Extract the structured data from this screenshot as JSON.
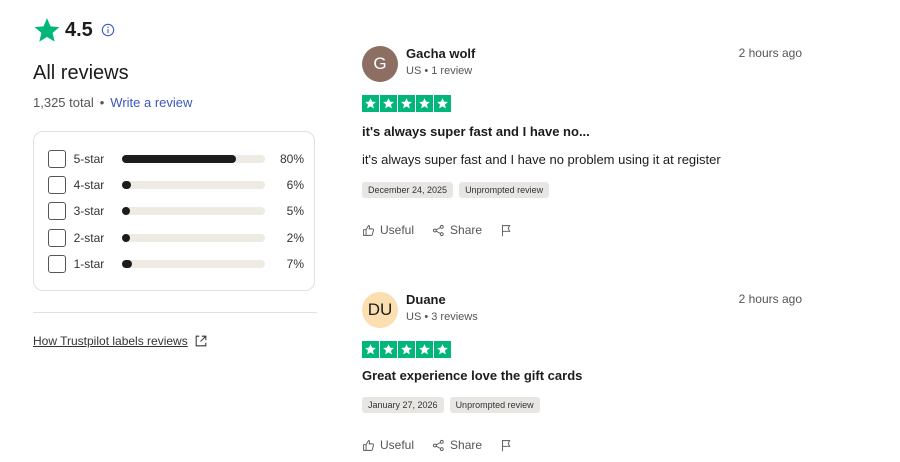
{
  "summary": {
    "rating": "4.5",
    "title": "All reviews",
    "total": "1,325 total",
    "separator": "•",
    "write_link": "Write a review",
    "labels_link": "How Trustpilot labels reviews"
  },
  "distribution": [
    {
      "label": "5-star",
      "percent": "80%",
      "fraction": 0.8
    },
    {
      "label": "4-star",
      "percent": "6%",
      "fraction": 0.06
    },
    {
      "label": "3-star",
      "percent": "5%",
      "fraction": 0.05
    },
    {
      "label": "2-star",
      "percent": "2%",
      "fraction": 0.02
    },
    {
      "label": "1-star",
      "percent": "7%",
      "fraction": 0.07
    }
  ],
  "reviews": [
    {
      "avatar_text": "G",
      "avatar_bg": "#8d6e63",
      "avatar_fg": "#ffffff",
      "name": "Gacha wolf",
      "meta": "US • 1 review",
      "time": "2 hours ago",
      "stars": 5,
      "title": "it's always super fast and I have no...",
      "body": "it's always super fast and I have no problem using it at register",
      "date_tag": "December 24, 2025",
      "source_tag": "Unprompted review",
      "useful": "Useful",
      "share": "Share"
    },
    {
      "avatar_text": "DU",
      "avatar_bg": "#fbdfb0",
      "avatar_fg": "#1c1c1c",
      "name": "Duane",
      "meta": "US • 3 reviews",
      "time": "2 hours ago",
      "stars": 5,
      "title": "Great experience love the gift cards",
      "body": "",
      "date_tag": "January 27, 2026",
      "source_tag": "Unprompted review",
      "useful": "Useful",
      "share": "Share"
    }
  ],
  "colors": {
    "trustpilot_green": "#00b67a",
    "link_blue": "#3c57bc",
    "bar_fill": "#1c1c1c",
    "bar_track": "#eeeae4"
  },
  "icons": {
    "rating_star": "star-icon",
    "info": "info-icon",
    "external_link": "external-link-icon",
    "useful": "thumbs-up-icon",
    "share": "share-icon",
    "flag": "flag-icon"
  }
}
